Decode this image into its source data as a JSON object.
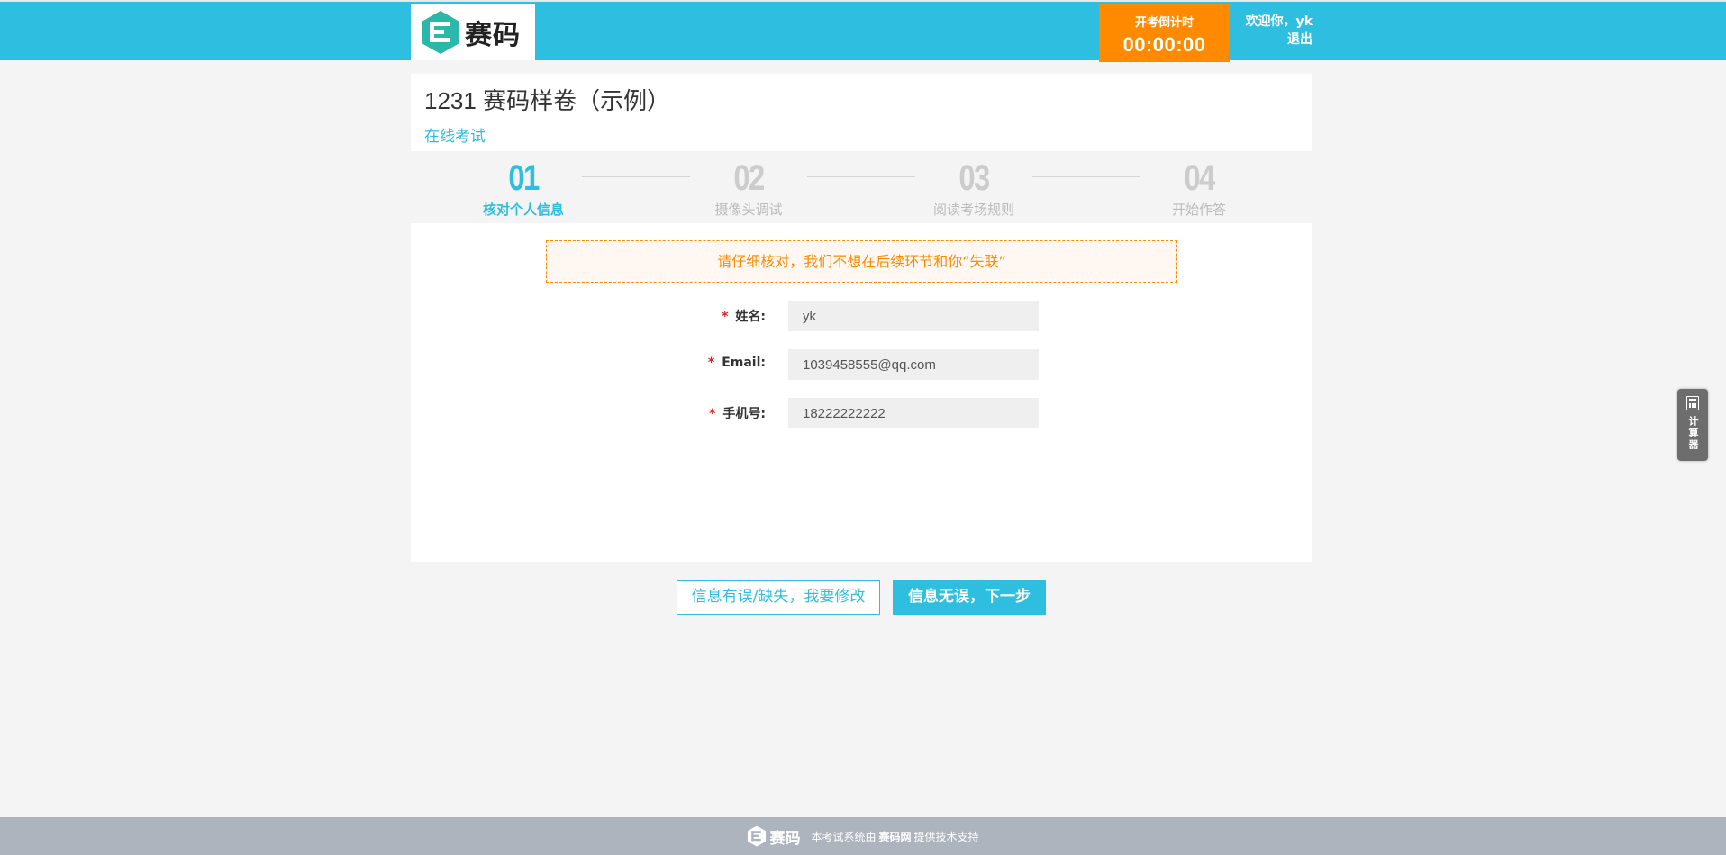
{
  "header": {
    "logo_text": "赛码",
    "timer_label": "开考倒计时",
    "timer_value": "00:00:00",
    "welcome": "欢迎你，yk",
    "logout": "退出",
    "colors": {
      "primary": "#2ebedf",
      "timer": "#ff8a00"
    }
  },
  "exam": {
    "title": "1231 赛码样卷（示例）",
    "subtitle": "在线考试"
  },
  "steps": [
    {
      "num": "01",
      "label": "核对个人信息",
      "active": true
    },
    {
      "num": "02",
      "label": "摄像头调试",
      "active": false
    },
    {
      "num": "03",
      "label": "阅读考场规则",
      "active": false
    },
    {
      "num": "04",
      "label": "开始作答",
      "active": false
    }
  ],
  "notice": "请仔细核对，我们不想在后续环节和你“失联”",
  "form": {
    "required_mark": "*",
    "name_label": "姓名:",
    "name_value": "yk",
    "email_label": "Email:",
    "email_value": "1039458555@qq.com",
    "phone_label": "手机号:",
    "phone_value": "18222222222"
  },
  "buttons": {
    "edit": "信息有误/缺失，我要修改",
    "next": "信息无误，下一步"
  },
  "calculator": {
    "icon": "calculator-icon",
    "label": "计算器"
  },
  "footer": {
    "logo_text": "赛码",
    "text_before": "本考试系统由",
    "brand": "赛码网",
    "text_after": "提供技术支持"
  }
}
